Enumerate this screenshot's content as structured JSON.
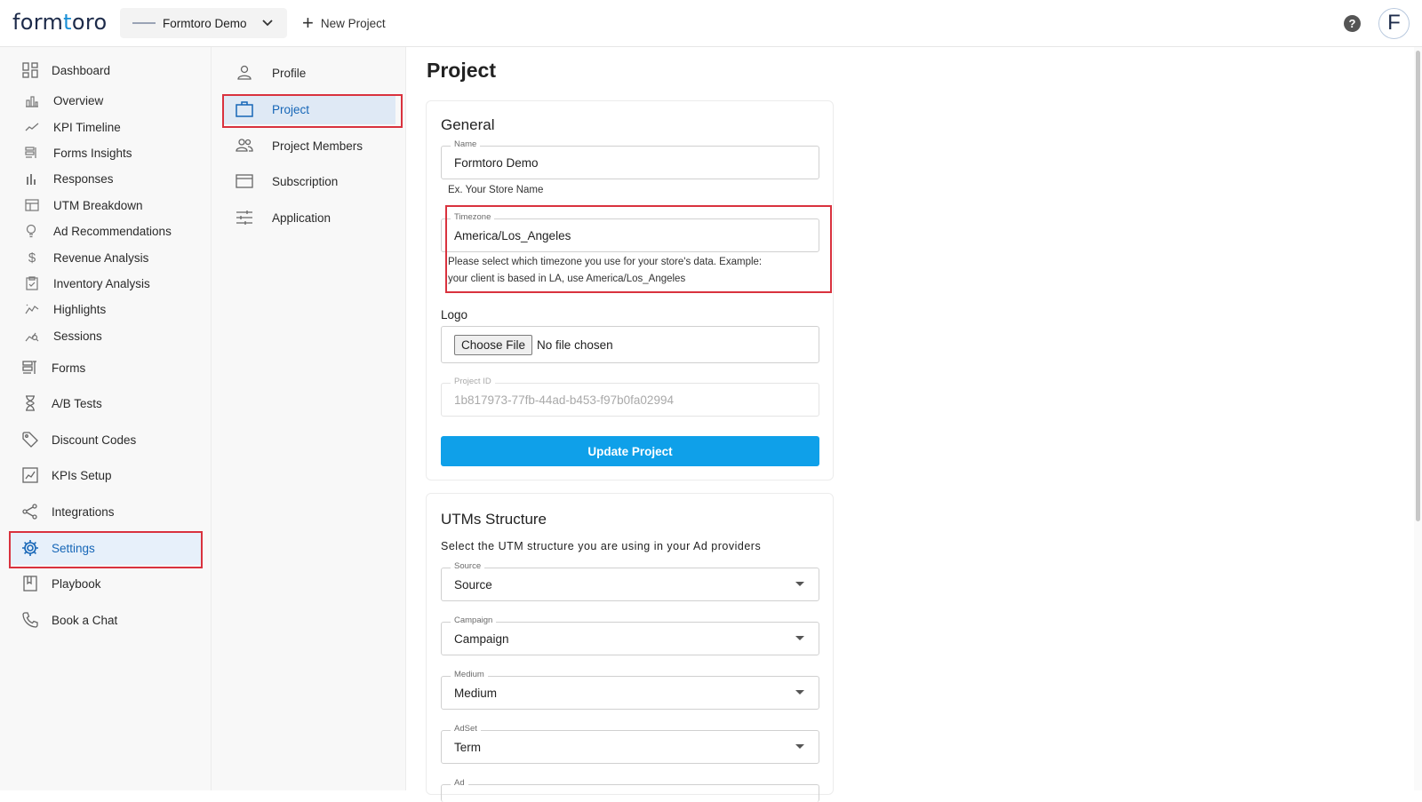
{
  "app": {
    "logo_left": "form",
    "logo_accent": "t",
    "logo_right": "oro"
  },
  "header": {
    "project_name": "Formtoro Demo",
    "new_project_label": "New Project",
    "help_glyph": "?",
    "avatar_letter": "F"
  },
  "sidebar": {
    "items": [
      {
        "label": "Dashboard",
        "icon": "dashboard-icon"
      },
      {
        "label": "Overview",
        "icon": "bar-chart-icon"
      },
      {
        "label": "KPI Timeline",
        "icon": "trend-line-icon"
      },
      {
        "label": "Forms Insights",
        "icon": "forms-insights-icon"
      },
      {
        "label": "Responses",
        "icon": "responses-chart-icon"
      },
      {
        "label": "UTM Breakdown",
        "icon": "table-icon"
      },
      {
        "label": "Ad Recommendations",
        "icon": "lightbulb-icon"
      },
      {
        "label": "Revenue Analysis",
        "icon": "dollar-icon"
      },
      {
        "label": "Inventory Analysis",
        "icon": "clipboard-check-icon"
      },
      {
        "label": "Highlights",
        "icon": "highlights-chart-icon"
      },
      {
        "label": "Sessions",
        "icon": "sessions-icon"
      },
      {
        "label": "Forms",
        "icon": "forms-icon"
      },
      {
        "label": "A/B Tests",
        "icon": "hourglass-icon"
      },
      {
        "label": "Discount Codes",
        "icon": "tag-icon"
      },
      {
        "label": "KPIs Setup",
        "icon": "kpi-setup-icon"
      },
      {
        "label": "Integrations",
        "icon": "share-icon"
      },
      {
        "label": "Settings",
        "icon": "gear-icon"
      },
      {
        "label": "Playbook",
        "icon": "book-icon"
      },
      {
        "label": "Book a Chat",
        "icon": "phone-icon"
      }
    ],
    "active": "Settings"
  },
  "settings_menu": {
    "items": [
      {
        "label": "Profile",
        "icon": "person-icon"
      },
      {
        "label": "Project",
        "icon": "briefcase-icon"
      },
      {
        "label": "Project Members",
        "icon": "people-icon"
      },
      {
        "label": "Subscription",
        "icon": "credit-card-icon"
      },
      {
        "label": "Application",
        "icon": "sliders-icon"
      }
    ],
    "active": "Project"
  },
  "main": {
    "title": "Project",
    "general": {
      "title": "General",
      "name_label": "Name",
      "name_value": "Formtoro Demo",
      "name_helper": "Ex. Your Store Name",
      "timezone_label": "Timezone",
      "timezone_value": "America/Los_Angeles",
      "timezone_helper_line1": "Please select which timezone you use for your store's data. Example:",
      "timezone_helper_line2": "your client is based in LA, use America/Los_Angeles",
      "logo_label": "Logo",
      "choose_file": "Choose File",
      "no_file": "No file chosen",
      "project_id_label": "Project ID",
      "project_id_value": "1b817973-77fb-44ad-b453-f97b0fa02994",
      "update_button": "Update Project"
    },
    "utms": {
      "title": "UTMs Structure",
      "subtitle": "Select the UTM structure you are using in your Ad providers",
      "fields": [
        {
          "label": "Source",
          "value": "Source"
        },
        {
          "label": "Campaign",
          "value": "Campaign"
        },
        {
          "label": "Medium",
          "value": "Medium"
        },
        {
          "label": "AdSet",
          "value": "Term"
        },
        {
          "label": "Ad",
          "value": ""
        }
      ]
    }
  },
  "colors": {
    "primary": "#0fa0e9",
    "active_text": "#1666b7",
    "highlight_border": "#d9323e"
  }
}
